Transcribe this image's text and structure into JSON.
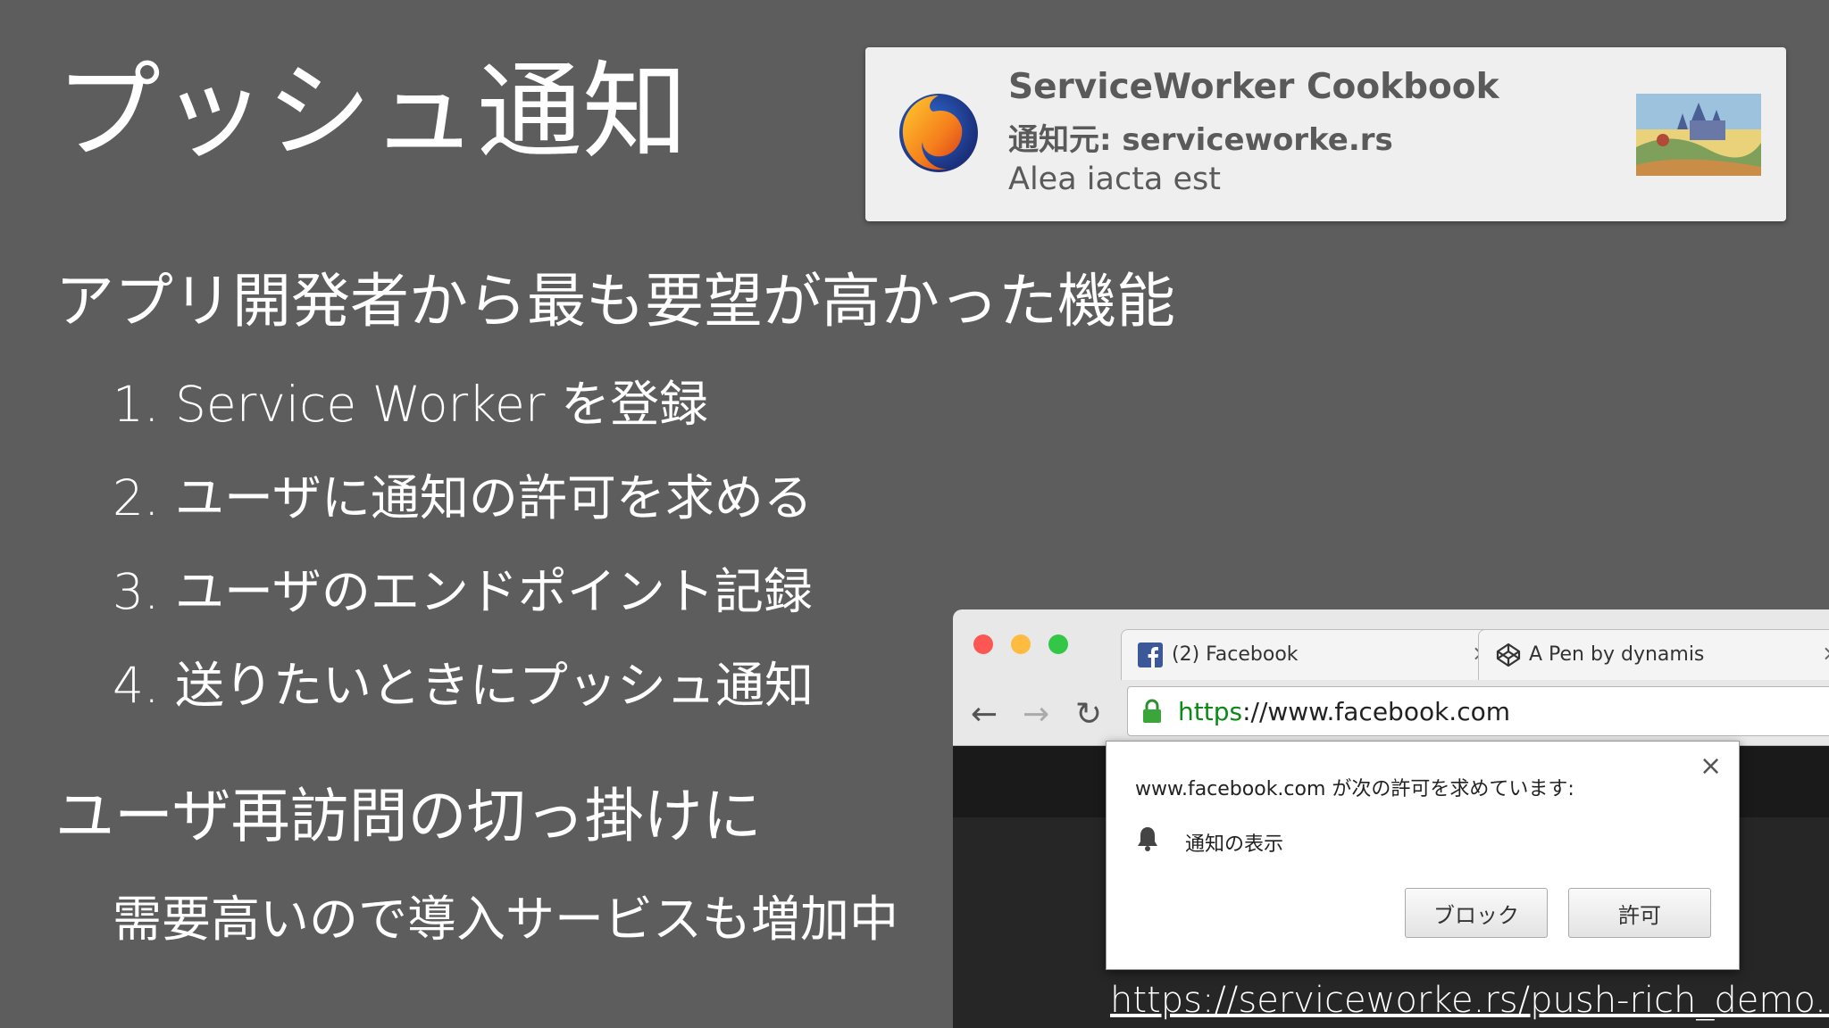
{
  "slide": {
    "title": "プッシュ通知",
    "heading1": "アプリ開発者から最も要望が高かった機能",
    "steps": [
      "1. Service Worker を登録",
      "2. ユーザに通知の許可を求める",
      "3. ユーザのエンドポイント記録",
      "4. 送りたいときにプッシュ通知"
    ],
    "heading2": "ユーザ再訪問の切っ掛けに",
    "sub2": "需要高いので導入サービスも増加中",
    "link": "https://serviceworke.rs/push-rich_demo.html"
  },
  "notification": {
    "icon": "firefox-logo-icon",
    "title": "ServiceWorker Cookbook",
    "source": "通知元: serviceworke.rs",
    "body": "Alea iacta est"
  },
  "browser": {
    "tabs": [
      {
        "icon": "facebook-icon",
        "label": "(2) Facebook",
        "close": "×"
      },
      {
        "icon": "codepen-icon",
        "label": "A Pen by dynamis",
        "close": "×"
      }
    ],
    "url_scheme": "https",
    "url_rest": "://www.facebook.com",
    "colors": {
      "close": "#fc5753",
      "minimize": "#fdbc40",
      "zoom": "#33c748"
    }
  },
  "permission": {
    "question": "www.facebook.com が次の許可を求めています:",
    "item": "通知の表示",
    "close": "×",
    "block_label": "ブロック",
    "allow_label": "許可"
  }
}
